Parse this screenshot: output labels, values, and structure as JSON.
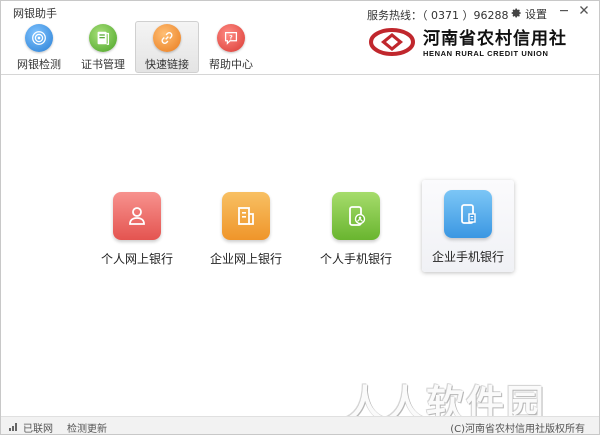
{
  "app": {
    "title": "网银助手",
    "hotline": "服务热线：（ 0371 ）96288",
    "settings_label": "设置"
  },
  "nav": {
    "items": [
      {
        "label": "网银检测",
        "icon": "radar-icon",
        "color": "#3b8ee0"
      },
      {
        "label": "证书管理",
        "icon": "certificate-icon",
        "color": "#5cb531"
      },
      {
        "label": "快速链接",
        "icon": "link-icon",
        "color": "#f08a2c"
      },
      {
        "label": "帮助中心",
        "icon": "help-bubble-icon",
        "color": "#e8483f"
      }
    ],
    "active_index": 2
  },
  "brand": {
    "name_cn": "河南省农村信用社",
    "name_en": "HENAN RURAL CREDIT UNION",
    "color": "#c0272d"
  },
  "tiles": [
    {
      "label": "个人网上银行",
      "icon": "person-icon",
      "color": "#ea5d59"
    },
    {
      "label": "企业网上银行",
      "icon": "building-icon",
      "color": "#f2a23a"
    },
    {
      "label": "个人手机银行",
      "icon": "phone-person-icon",
      "color": "#7dc341"
    },
    {
      "label": "企业手机银行",
      "icon": "phone-building-icon",
      "color": "#4aa8e8"
    }
  ],
  "status": {
    "network": "已联网",
    "update": "检测更新",
    "copyright": "(C)河南省农村信用社版权所有"
  },
  "watermark": "人人软件园"
}
